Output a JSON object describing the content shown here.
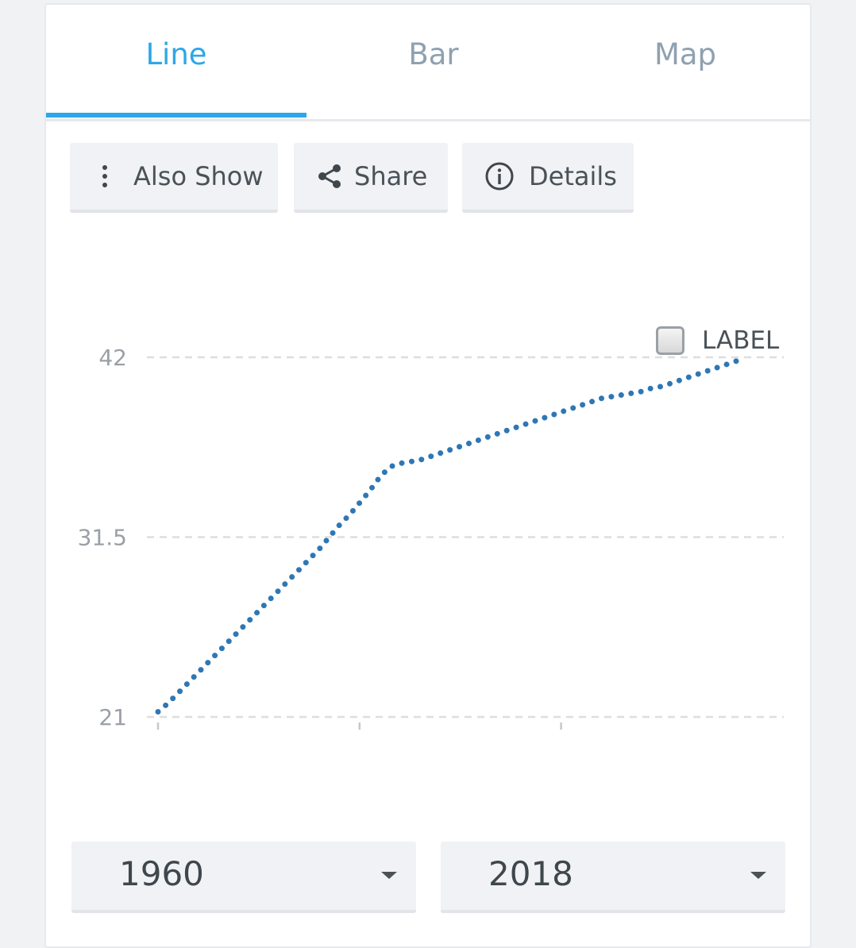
{
  "tabs": [
    {
      "label": "Line",
      "active": true
    },
    {
      "label": "Bar",
      "active": false
    },
    {
      "label": "Map",
      "active": false
    }
  ],
  "toolbar": {
    "also_show": {
      "label": "Also Show",
      "icon": "more-vertical-icon"
    },
    "share": {
      "label": "Share",
      "icon": "share-icon"
    },
    "details": {
      "label": "Details",
      "icon": "info-icon"
    }
  },
  "legend": {
    "label": "LABEL",
    "checked": false
  },
  "colors": {
    "accent": "#2da7e8",
    "series": "#2e77b5"
  },
  "range": {
    "start": "1960",
    "end": "2018"
  },
  "chart_data": {
    "type": "line",
    "style": "dotted",
    "x": [
      1960,
      1961,
      1962,
      1963,
      1964,
      1965,
      1966,
      1967,
      1968,
      1969,
      1970,
      1971,
      1972,
      1973,
      1974,
      1975,
      1976,
      1977,
      1978,
      1979,
      1980,
      1981,
      1982,
      1983,
      1984,
      1985,
      1986,
      1987,
      1988,
      1989,
      1990,
      1991,
      1992,
      1993,
      1994,
      1995,
      1996,
      1997,
      1998,
      1999,
      2000,
      2001,
      2002,
      2003,
      2004,
      2005,
      2006,
      2007,
      2008,
      2009,
      2010,
      2011,
      2012,
      2013,
      2014,
      2015,
      2016,
      2017,
      2018
    ],
    "series": [
      {
        "values": [
          21.3,
          21.8,
          22.4,
          23.0,
          23.6,
          24.2,
          24.8,
          25.4,
          26.0,
          26.6,
          27.2,
          27.8,
          28.4,
          29.0,
          29.6,
          30.2,
          30.8,
          31.5,
          32.2,
          32.8,
          33.5,
          34.2,
          35.0,
          35.6,
          35.8,
          35.9,
          36.0,
          36.2,
          36.4,
          36.6,
          36.8,
          37.0,
          37.2,
          37.4,
          37.6,
          37.8,
          38.0,
          38.2,
          38.4,
          38.6,
          38.8,
          39.0,
          39.2,
          39.4,
          39.6,
          39.7,
          39.8,
          39.9,
          40.0,
          40.2,
          40.3,
          40.5,
          40.7,
          40.9,
          41.1,
          41.3,
          41.5,
          41.7,
          41.9
        ]
      }
    ],
    "yticks": [
      "42",
      "31.5",
      "21"
    ],
    "ylim": [
      21,
      42
    ],
    "xlim": [
      1960,
      2018
    ],
    "x_tick_marks": [
      1960,
      1980,
      2000
    ],
    "grid": true,
    "legend_position": "top-right"
  }
}
